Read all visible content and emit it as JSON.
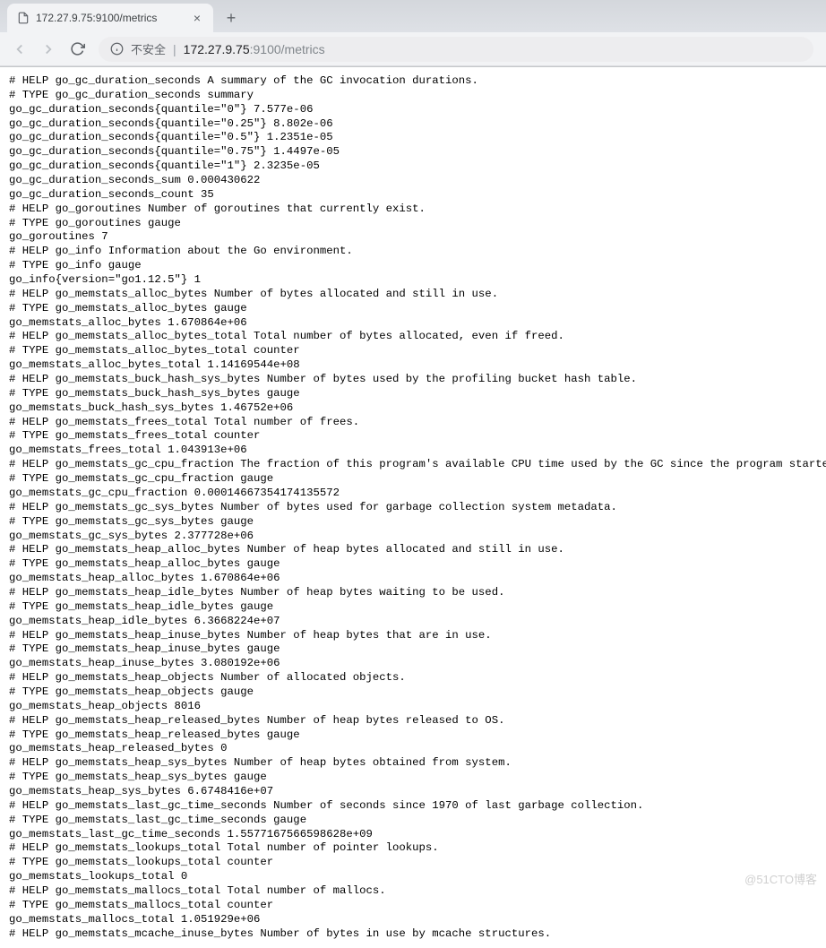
{
  "browser": {
    "tab": {
      "title": "172.27.9.75:9100/metrics"
    },
    "toolbar": {
      "security_label": "不安全",
      "url_host": "172.27.9.75",
      "url_port_path": ":9100/metrics"
    }
  },
  "metrics_lines": [
    "# HELP go_gc_duration_seconds A summary of the GC invocation durations.",
    "# TYPE go_gc_duration_seconds summary",
    "go_gc_duration_seconds{quantile=\"0\"} 7.577e-06",
    "go_gc_duration_seconds{quantile=\"0.25\"} 8.802e-06",
    "go_gc_duration_seconds{quantile=\"0.5\"} 1.2351e-05",
    "go_gc_duration_seconds{quantile=\"0.75\"} 1.4497e-05",
    "go_gc_duration_seconds{quantile=\"1\"} 2.3235e-05",
    "go_gc_duration_seconds_sum 0.000430622",
    "go_gc_duration_seconds_count 35",
    "# HELP go_goroutines Number of goroutines that currently exist.",
    "# TYPE go_goroutines gauge",
    "go_goroutines 7",
    "# HELP go_info Information about the Go environment.",
    "# TYPE go_info gauge",
    "go_info{version=\"go1.12.5\"} 1",
    "# HELP go_memstats_alloc_bytes Number of bytes allocated and still in use.",
    "# TYPE go_memstats_alloc_bytes gauge",
    "go_memstats_alloc_bytes 1.670864e+06",
    "# HELP go_memstats_alloc_bytes_total Total number of bytes allocated, even if freed.",
    "# TYPE go_memstats_alloc_bytes_total counter",
    "go_memstats_alloc_bytes_total 1.14169544e+08",
    "# HELP go_memstats_buck_hash_sys_bytes Number of bytes used by the profiling bucket hash table.",
    "# TYPE go_memstats_buck_hash_sys_bytes gauge",
    "go_memstats_buck_hash_sys_bytes 1.46752e+06",
    "# HELP go_memstats_frees_total Total number of frees.",
    "# TYPE go_memstats_frees_total counter",
    "go_memstats_frees_total 1.043913e+06",
    "# HELP go_memstats_gc_cpu_fraction The fraction of this program's available CPU time used by the GC since the program started.",
    "# TYPE go_memstats_gc_cpu_fraction gauge",
    "go_memstats_gc_cpu_fraction 0.00014667354174135572",
    "# HELP go_memstats_gc_sys_bytes Number of bytes used for garbage collection system metadata.",
    "# TYPE go_memstats_gc_sys_bytes gauge",
    "go_memstats_gc_sys_bytes 2.377728e+06",
    "# HELP go_memstats_heap_alloc_bytes Number of heap bytes allocated and still in use.",
    "# TYPE go_memstats_heap_alloc_bytes gauge",
    "go_memstats_heap_alloc_bytes 1.670864e+06",
    "# HELP go_memstats_heap_idle_bytes Number of heap bytes waiting to be used.",
    "# TYPE go_memstats_heap_idle_bytes gauge",
    "go_memstats_heap_idle_bytes 6.3668224e+07",
    "# HELP go_memstats_heap_inuse_bytes Number of heap bytes that are in use.",
    "# TYPE go_memstats_heap_inuse_bytes gauge",
    "go_memstats_heap_inuse_bytes 3.080192e+06",
    "# HELP go_memstats_heap_objects Number of allocated objects.",
    "# TYPE go_memstats_heap_objects gauge",
    "go_memstats_heap_objects 8016",
    "# HELP go_memstats_heap_released_bytes Number of heap bytes released to OS.",
    "# TYPE go_memstats_heap_released_bytes gauge",
    "go_memstats_heap_released_bytes 0",
    "# HELP go_memstats_heap_sys_bytes Number of heap bytes obtained from system.",
    "# TYPE go_memstats_heap_sys_bytes gauge",
    "go_memstats_heap_sys_bytes 6.6748416e+07",
    "# HELP go_memstats_last_gc_time_seconds Number of seconds since 1970 of last garbage collection.",
    "# TYPE go_memstats_last_gc_time_seconds gauge",
    "go_memstats_last_gc_time_seconds 1.5577167566598628e+09",
    "# HELP go_memstats_lookups_total Total number of pointer lookups.",
    "# TYPE go_memstats_lookups_total counter",
    "go_memstats_lookups_total 0",
    "# HELP go_memstats_mallocs_total Total number of mallocs.",
    "# TYPE go_memstats_mallocs_total counter",
    "go_memstats_mallocs_total 1.051929e+06",
    "# HELP go_memstats_mcache_inuse_bytes Number of bytes in use by mcache structures."
  ],
  "watermark": "@51CTO博客"
}
